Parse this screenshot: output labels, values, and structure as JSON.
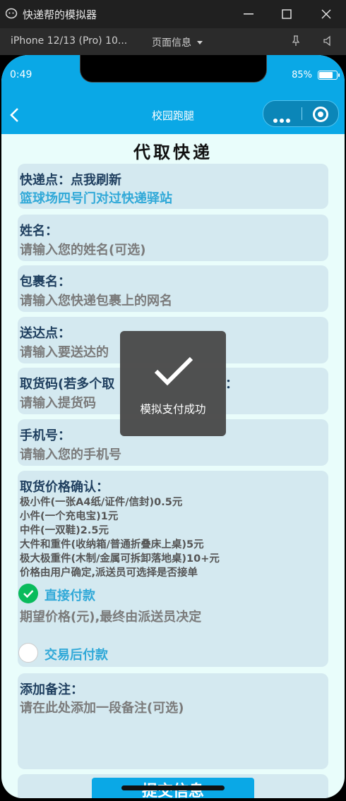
{
  "window": {
    "title": "快递帮的模拟器",
    "device": "iPhone 12/13 (Pro) 10...",
    "page_info": "页面信息"
  },
  "status": {
    "time": "0:49",
    "battery": "85%",
    "battery_level": 0.85
  },
  "nav": {
    "title": "校园跑腿"
  },
  "page": {
    "heading": "代取快递"
  },
  "form": {
    "pickup_point": {
      "label": "快递点：点我刷新",
      "value": "篮球场四号门对过快递驿站"
    },
    "name": {
      "label": "姓名：",
      "placeholder": "请输入您的姓名(可选)"
    },
    "package_name": {
      "label": "包裹名：",
      "placeholder": "请输入您快递包裹上的网名"
    },
    "delivery_point": {
      "label": "送达点：",
      "placeholder": "请输入要送达的"
    },
    "pickup_code": {
      "label": "取货码(若多个取",
      "label_tail": "：",
      "placeholder": "请输入提货码"
    },
    "phone": {
      "label": "手机号：",
      "placeholder": "请输入您的手机号"
    },
    "price": {
      "label": "取货价格确认：",
      "rules": [
        "极小件(一张A4纸/证件/信封)0.5元",
        "小件(一个充电宝)1元",
        "中件(一双鞋)2.5元",
        "大件和重件(收纳箱/普通折叠床上桌)5元",
        "极大极重件(木制/金属可拆卸落地桌)10+元",
        "价格由用户确定,派送员可选择是否接单"
      ],
      "option_direct": "直接付款",
      "expected_price_placeholder": "期望价格(元),最终由派送员决定",
      "option_after": "交易后付款"
    },
    "note": {
      "label": "添加备注：",
      "placeholder": "请在此处添加一段备注(可选)"
    },
    "submit": "提交信息"
  },
  "toast": {
    "text": "模拟支付成功"
  },
  "colors": {
    "accent": "#0aa8e6",
    "success": "#09bb5c",
    "card": "#d4e9f0",
    "link": "#31a9d8"
  }
}
